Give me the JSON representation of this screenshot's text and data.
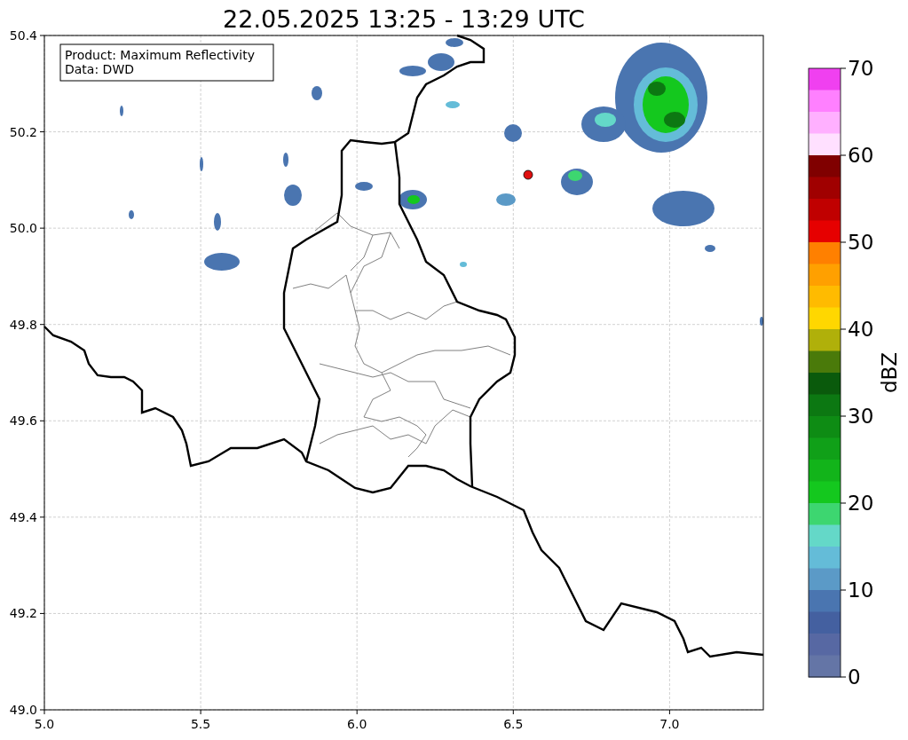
{
  "title": "22.05.2025 13:25 - 13:29 UTC",
  "legend": [
    "Product: Maximum Reflectivity",
    "Data: DWD"
  ],
  "x_ticks": [
    "5.0",
    "5.5",
    "6.0",
    "6.5",
    "7.0"
  ],
  "y_ticks": [
    "50.4",
    "50.2",
    "50.0",
    "49.8",
    "49.6",
    "49.4",
    "49.2",
    "49.0"
  ],
  "colorbar": {
    "label": "dBZ",
    "ticks": [
      "70",
      "60",
      "50",
      "40",
      "30",
      "20",
      "10",
      "0"
    ],
    "segments": [
      {
        "color": "#f040f0"
      },
      {
        "color": "#ff80ff"
      },
      {
        "color": "#ffb0ff"
      },
      {
        "color": "#ffe0ff"
      },
      {
        "color": "#800000"
      },
      {
        "color": "#a00000"
      },
      {
        "color": "#c00000"
      },
      {
        "color": "#e60000"
      },
      {
        "color": "#ff8000"
      },
      {
        "color": "#ffa000"
      },
      {
        "color": "#ffbb00"
      },
      {
        "color": "#ffd700"
      },
      {
        "color": "#b0b00a"
      },
      {
        "color": "#4a7a0a"
      },
      {
        "color": "#0a5a0c"
      },
      {
        "color": "#0c7812"
      },
      {
        "color": "#0e8c14"
      },
      {
        "color": "#10a018"
      },
      {
        "color": "#12b41a"
      },
      {
        "color": "#14c81e"
      },
      {
        "color": "#3dd670"
      },
      {
        "color": "#64d8c8"
      },
      {
        "color": "#64bcd8"
      },
      {
        "color": "#5b9ac7"
      },
      {
        "color": "#4a75b0"
      },
      {
        "color": "#4460a0"
      },
      {
        "color": "#5768a3"
      },
      {
        "color": "#6475a6"
      }
    ]
  }
}
